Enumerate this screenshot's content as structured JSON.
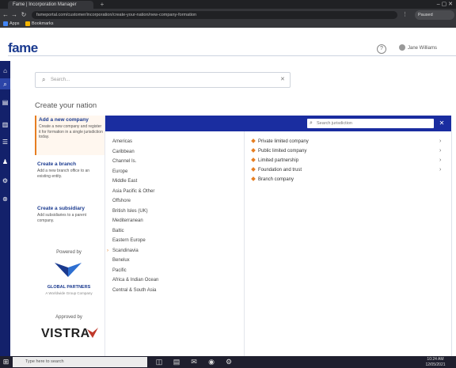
{
  "browser": {
    "tab_title": "Fame | Incorporation Manager",
    "new_tab_symbol": "+",
    "window_controls": "–  ▢  ✕",
    "back_symbol": "←",
    "forward_symbol": "→",
    "reload_symbol": "↻",
    "url": "fameportal.com/customer/incorporation/create-your-nation/new-company-formation",
    "extensions_symbol": "⋮",
    "account_label": "Paused",
    "bookmarks": [
      {
        "label": "Apps",
        "color": "#4285f4"
      },
      {
        "label": "Bookmarks",
        "color": "#f4b400"
      }
    ]
  },
  "header": {
    "brand": "fame",
    "help_symbol": "?",
    "user_name": "Jane Williams"
  },
  "rail": {
    "icons": [
      "home-icon",
      "search-icon",
      "documents-icon",
      "files-icon",
      "list-icon",
      "people-icon",
      "settings-icon",
      "globe-icon"
    ]
  },
  "search": {
    "icon": "⌕",
    "placeholder": "Search...",
    "clear": "✕"
  },
  "create": {
    "title": "Create your nation"
  },
  "cards": [
    {
      "title": "Add a new company",
      "desc": "Create a new company and register it for formation in a single jurisdiction today."
    },
    {
      "title": "Create a branch",
      "desc": "Add a new branch office to an existing entity."
    },
    {
      "title": "Create a subsidiary",
      "desc": "Add subsidiaries to a parent company."
    }
  ],
  "partners": {
    "powered_by": "Powered by",
    "moody_name": "GLOBAL PARTNERS",
    "moody_sub": "A Worldwide Group Company",
    "approved_by": "Approved by",
    "vistra": "VISTRA"
  },
  "panel": {
    "search_placeholder": "Search jurisdiction",
    "search_icon": "⌕",
    "close": "✕",
    "categories": [
      "Americas",
      "Caribbean",
      "Channel Is.",
      "Europe",
      "Middle East",
      "Asia Pacific & Other",
      "Offshore",
      "British Isles (UK)",
      "Mediterranean",
      "Baltic",
      "Eastern Europe",
      "Scandinavia",
      "Benelux",
      "Pacific",
      "Africa & Indian Ocean",
      "Central & South Asia"
    ],
    "category_marker": "›",
    "subitems": [
      {
        "label": "Private limited company",
        "chevron": "›"
      },
      {
        "label": "Public limited company",
        "chevron": "›"
      },
      {
        "label": "Limited partnership",
        "chevron": "›"
      },
      {
        "label": "Foundation and trust",
        "chevron": "›"
      },
      {
        "label": "Branch company",
        "chevron": ""
      }
    ]
  },
  "taskbar": {
    "start_symbol": "⊞",
    "search_placeholder": "Type here to search",
    "icons": [
      {
        "name": "task-view-icon",
        "symbol": "◫"
      },
      {
        "name": "file-explorer-icon",
        "symbol": "▤"
      },
      {
        "name": "mail-icon",
        "symbol": "✉"
      },
      {
        "name": "chrome-icon",
        "symbol": "◉"
      },
      {
        "name": "settings-icon",
        "symbol": "⚙"
      }
    ],
    "time": "10:24 AM",
    "date": "12/05/2021"
  }
}
